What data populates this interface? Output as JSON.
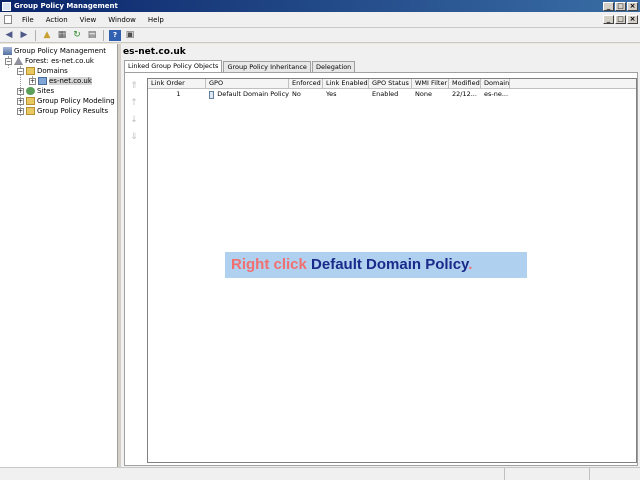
{
  "window": {
    "title": "Group Policy Management"
  },
  "titlebar_buttons": [
    "_",
    "□",
    "×"
  ],
  "menu": {
    "items": [
      "File",
      "Action",
      "View",
      "Window",
      "Help"
    ],
    "child_buttons": [
      "_",
      "□",
      "×"
    ]
  },
  "toolbar": {
    "icons": [
      "back-arrow-icon",
      "forward-arrow-icon",
      "up-folder-icon",
      "show-hide-tree-icon",
      "refresh-icon",
      "export-list-icon",
      "help-icon",
      "properties-icon"
    ]
  },
  "tree": {
    "root": "Group Policy Management",
    "forest": "Forest: es-net.co.uk",
    "domains": "Domains",
    "domain": "es-net.co.uk",
    "sites": "Sites",
    "modeling": "Group Policy Modeling",
    "results": "Group Policy Results"
  },
  "main": {
    "title": "es-net.co.uk",
    "tabs": [
      "Linked Group Policy Objects",
      "Group Policy Inheritance",
      "Delegation"
    ],
    "side_buttons": [
      "⇑",
      "↑",
      "↓",
      "⇓"
    ],
    "table": {
      "columns": [
        "Link Order",
        "GPO",
        "Enforced",
        "Link Enabled",
        "GPO Status",
        "WMI Filter",
        "Modified",
        "Domain"
      ],
      "rows": [
        {
          "link_order": "1",
          "gpo": "Default Domain Policy",
          "enforced": "No",
          "link_enabled": "Yes",
          "gpo_status": "Enabled",
          "wmi_filter": "None",
          "modified": "22/12...",
          "domain": "es-ne..."
        }
      ]
    }
  },
  "callout": {
    "part1": "Right click ",
    "part2": "Default Domain Policy",
    "part3": "."
  },
  "colors": {
    "titlebar": "#0a246a",
    "callout_bg": "#b0d0f0",
    "callout_highlight": "#f07070",
    "callout_emphasis": "#1a2a8a"
  }
}
